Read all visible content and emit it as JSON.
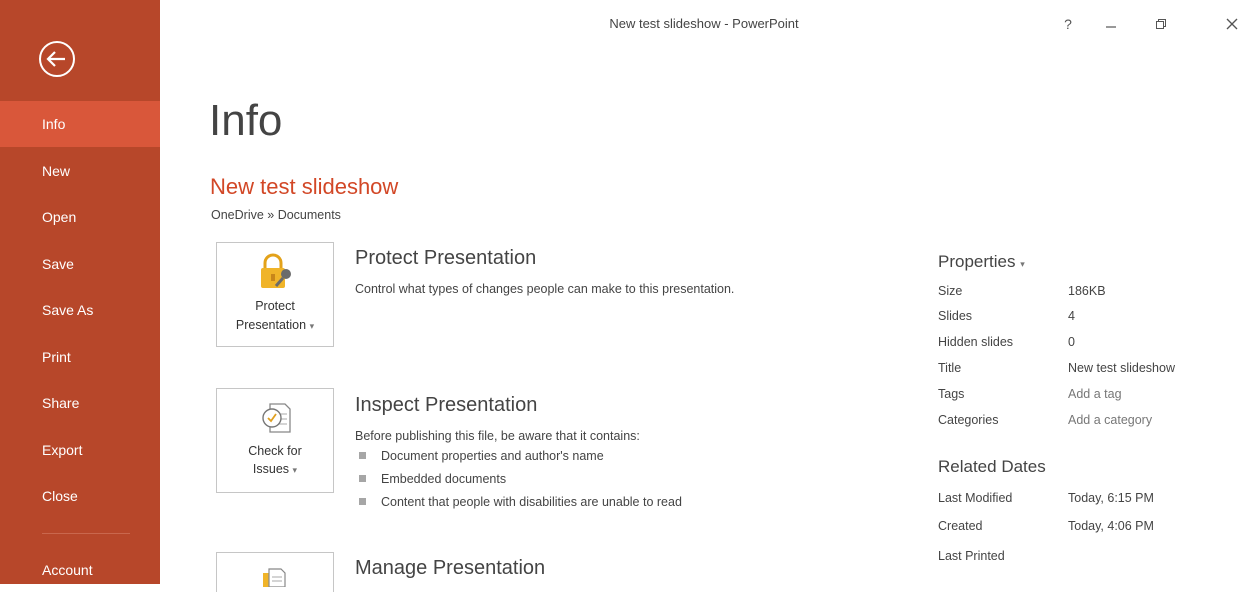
{
  "window": {
    "title": "New test slideshow - PowerPoint",
    "help_label": "?"
  },
  "sidebar": {
    "items": [
      {
        "label": "Info"
      },
      {
        "label": "New"
      },
      {
        "label": "Open"
      },
      {
        "label": "Save"
      },
      {
        "label": "Save As"
      },
      {
        "label": "Print"
      },
      {
        "label": "Share"
      },
      {
        "label": "Export"
      },
      {
        "label": "Close"
      },
      {
        "label": "Account"
      }
    ]
  },
  "main": {
    "heading": "Info",
    "doc_title": "New test slideshow",
    "doc_path": "OneDrive » Documents",
    "protect": {
      "button_line1": "Protect",
      "button_line2": "Presentation",
      "title": "Protect Presentation",
      "description": "Control what types of changes people can make to this presentation."
    },
    "inspect": {
      "button_line1": "Check for",
      "button_line2": "Issues",
      "title": "Inspect Presentation",
      "description": "Before publishing this file, be aware that it contains:",
      "bullets": [
        "Document properties and author's name",
        "Embedded documents",
        "Content that people with disabilities are unable to read"
      ]
    },
    "manage": {
      "title": "Manage Presentation"
    }
  },
  "properties": {
    "heading": "Properties",
    "rows": [
      {
        "label": "Size",
        "value": "186KB"
      },
      {
        "label": "Slides",
        "value": "4"
      },
      {
        "label": "Hidden slides",
        "value": "0"
      },
      {
        "label": "Title",
        "value": "New test slideshow"
      },
      {
        "label": "Tags",
        "value": "Add a tag"
      },
      {
        "label": "Categories",
        "value": "Add a category"
      }
    ]
  },
  "related_dates": {
    "heading": "Related Dates",
    "rows": [
      {
        "label": "Last Modified",
        "value": "Today, 6:15 PM"
      },
      {
        "label": "Created",
        "value": "Today, 4:06 PM"
      },
      {
        "label": "Last Printed",
        "value": ""
      }
    ]
  },
  "colors": {
    "sidebar": "#b7472a",
    "sidebar_active": "#d9573a",
    "accent_text": "#d24726"
  }
}
